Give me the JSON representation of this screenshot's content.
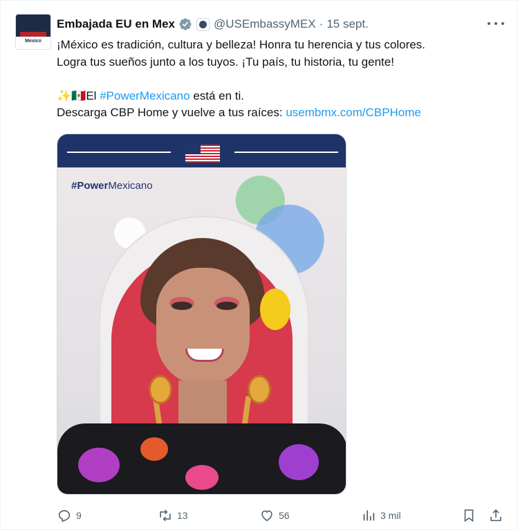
{
  "account": {
    "name": "Embajada EU en Mex",
    "handle": "@USEmbassyMEX",
    "separator": "·",
    "date": "15 sept.",
    "avatar_label": "Mexico"
  },
  "tweet": {
    "line1": "¡México es tradición, cultura y belleza! Honra tu herencia y tus colores.",
    "line2": "Logra tus sueños junto a los tuyos. ¡Tu país, tu historia, tu gente!",
    "line3_emoji": "✨🇲🇽",
    "line3_pre": "El ",
    "line3_hashtag": "#PowerMexicano",
    "line3_post": " está en ti.",
    "line4_pre": "Descarga CBP Home y vuelve a tus raíces: ",
    "line4_link": "usembmx.com/CBPHome"
  },
  "media": {
    "overlay_bold": "#Power",
    "overlay_light": "Mexicano"
  },
  "actions": {
    "replies": "9",
    "reposts": "13",
    "likes": "56",
    "views": "3 mil"
  },
  "colors": {
    "link": "#1d9bf0",
    "muted": "#536471",
    "verified": "#829aab",
    "banner": "#1e3469"
  },
  "icons": [
    "verified-badge-icon",
    "government-seal-icon",
    "more-icon",
    "reply-icon",
    "repost-icon",
    "like-icon",
    "views-icon",
    "bookmark-icon",
    "share-icon"
  ]
}
